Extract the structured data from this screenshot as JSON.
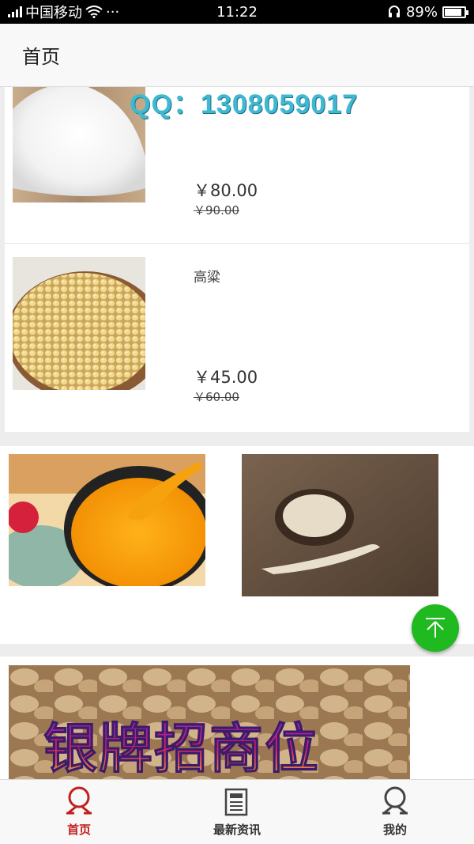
{
  "status_bar": {
    "network": "4G",
    "carrier": "中国移动",
    "more": "···",
    "time": "11:22",
    "battery": "89%",
    "battery_level": 0.89
  },
  "header": {
    "title": "首页"
  },
  "products": [
    {
      "name": "",
      "price": "￥80.00",
      "old_price": "￥90.00"
    },
    {
      "name": "高粱",
      "price": "￥45.00",
      "old_price": "￥60.00"
    }
  ],
  "overlay": {
    "qq_text": "QQ：1308059017"
  },
  "banner": {
    "text": "银牌招商位"
  },
  "nav": {
    "items": [
      {
        "label": "首页",
        "icon": "person-icon"
      },
      {
        "label": "最新资讯",
        "icon": "news-icon"
      },
      {
        "label": "我的",
        "icon": "profile-icon"
      }
    ]
  },
  "colors": {
    "accent": "#c21f1f",
    "top_button": "#1fba1f",
    "qq_text": "#3fb9d0"
  }
}
